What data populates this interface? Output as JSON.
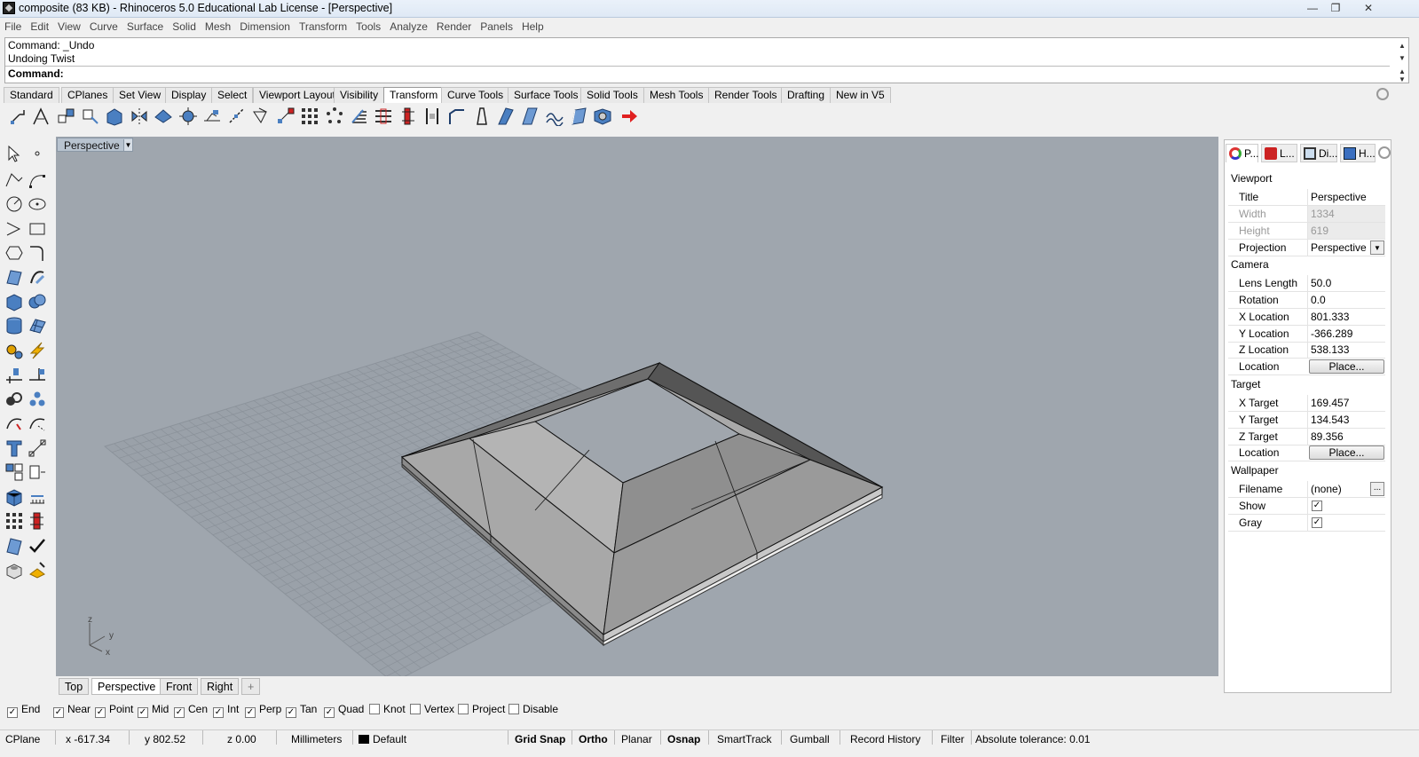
{
  "window": {
    "title": "composite (83 KB) - Rhinoceros 5.0 Educational Lab License - [Perspective]"
  },
  "menu": [
    "File",
    "Edit",
    "View",
    "Curve",
    "Surface",
    "Solid",
    "Mesh",
    "Dimension",
    "Transform",
    "Tools",
    "Analyze",
    "Render",
    "Panels",
    "Help"
  ],
  "command": {
    "history": [
      "Command: _Undo",
      "Undoing Twist"
    ],
    "prompt": "Command:"
  },
  "toolbar_tabs": [
    "Standard",
    "CPlanes",
    "Set View",
    "Display",
    "Select",
    "Viewport Layout",
    "Visibility",
    "Transform",
    "Curve Tools",
    "Surface Tools",
    "Solid Tools",
    "Mesh Tools",
    "Render Tools",
    "Drafting",
    "New in V5"
  ],
  "active_toolbar_tab": "Transform",
  "viewport": {
    "label": "Perspective",
    "axis_labels": {
      "z": "z",
      "y": "y",
      "x": "x"
    }
  },
  "viewport_tabs": [
    "Top",
    "Perspective",
    "Front",
    "Right",
    "+"
  ],
  "active_viewport_tab": "Perspective",
  "panel": {
    "tabs": [
      "P...",
      "L...",
      "Di...",
      "H..."
    ],
    "viewport_section": "Viewport",
    "title_label": "Title",
    "title_value": "Perspective",
    "width_label": "Width",
    "width_value": "1334",
    "height_label": "Height",
    "height_value": "619",
    "projection_label": "Projection",
    "projection_value": "Perspective",
    "camera_section": "Camera",
    "lens_label": "Lens Length",
    "lens_value": "50.0",
    "rotation_label": "Rotation",
    "rotation_value": "0.0",
    "xloc_label": "X Location",
    "xloc_value": "801.333",
    "yloc_label": "Y Location",
    "yloc_value": "-366.289",
    "zloc_label": "Z Location",
    "zloc_value": "538.133",
    "location_label": "Location",
    "place_button": "Place...",
    "target_section": "Target",
    "xtarget_label": "X Target",
    "xtarget_value": "169.457",
    "ytarget_label": "Y Target",
    "ytarget_value": "134.543",
    "ztarget_label": "Z Target",
    "ztarget_value": "89.356",
    "target_location_label": "Location",
    "target_place_button": "Place...",
    "wallpaper_section": "Wallpaper",
    "filename_label": "Filename",
    "filename_value": "(none)",
    "browse_button": "...",
    "show_label": "Show",
    "show_checked": true,
    "gray_label": "Gray",
    "gray_checked": true
  },
  "osnaps": [
    {
      "label": "End",
      "checked": true
    },
    {
      "label": "Near",
      "checked": true
    },
    {
      "label": "Point",
      "checked": true
    },
    {
      "label": "Mid",
      "checked": true
    },
    {
      "label": "Cen",
      "checked": true
    },
    {
      "label": "Int",
      "checked": true
    },
    {
      "label": "Perp",
      "checked": true
    },
    {
      "label": "Tan",
      "checked": true
    },
    {
      "label": "Quad",
      "checked": true
    },
    {
      "label": "Knot",
      "checked": false
    },
    {
      "label": "Vertex",
      "checked": false
    },
    {
      "label": "Project",
      "checked": false
    },
    {
      "label": "Disable",
      "checked": false
    }
  ],
  "status": {
    "cplane": "CPlane",
    "x": "x -617.34",
    "y": "y 802.52",
    "z": "z 0.00",
    "units": "Millimeters",
    "layer": "Default",
    "grid_snap": "Grid Snap",
    "ortho": "Ortho",
    "planar": "Planar",
    "osnap": "Osnap",
    "smarttrack": "SmartTrack",
    "gumball": "Gumball",
    "record_history": "Record History",
    "filter": "Filter",
    "tolerance": "Absolute tolerance: 0.01"
  },
  "colors": {
    "viewport_bg": "#9fa6ae",
    "grid": "#8e959d",
    "model_top": "#a9a9a9",
    "model_dark": "#5e5e5e",
    "model_inner": "#8f8f8f",
    "layer_swatch": "#000000"
  }
}
